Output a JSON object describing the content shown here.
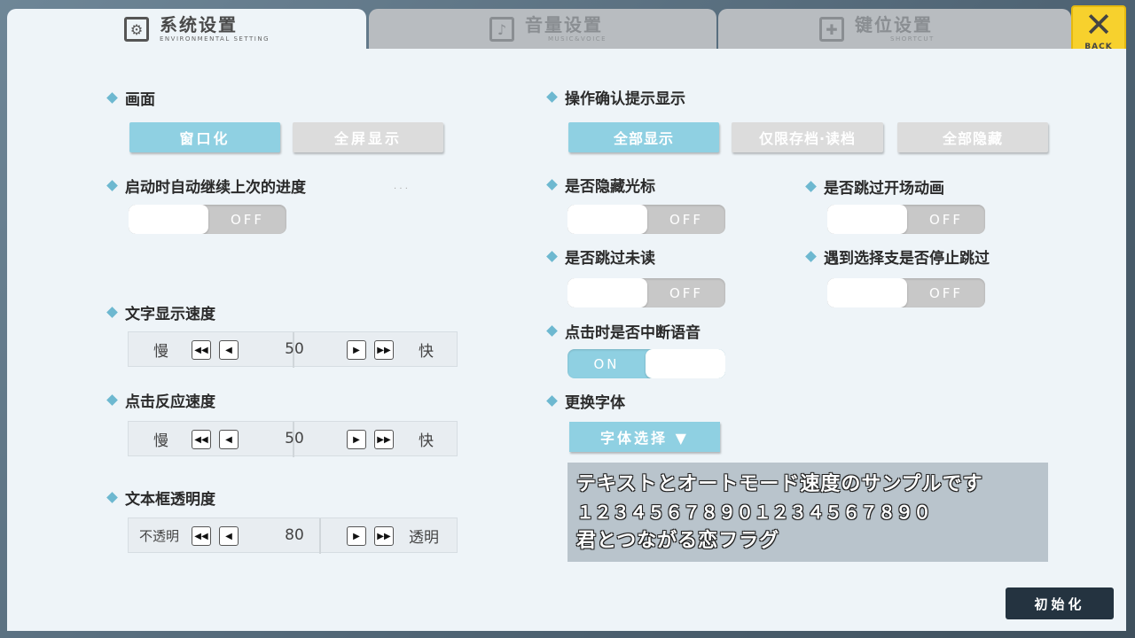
{
  "tabs": [
    {
      "title": "系统设置",
      "sub": "ENVIRONMENTAL SETTING",
      "icon": "⚙"
    },
    {
      "title": "音量设置",
      "sub": "MUSIC&VOICE",
      "icon": "♪"
    },
    {
      "title": "键位设置",
      "sub": "SHORTCUT",
      "icon": "✚"
    }
  ],
  "back": {
    "icon": "✕",
    "label": "BACK"
  },
  "left": {
    "screen": {
      "label": "画面",
      "options": [
        "窗口化",
        "全屏显示"
      ]
    },
    "auto_continue": {
      "label": "启动时自动继续上次的进度",
      "state": "OFF"
    },
    "text_speed": {
      "label": "文字显示速度",
      "min": "慢",
      "max": "快",
      "value": "50"
    },
    "click_speed": {
      "label": "点击反应速度",
      "min": "慢",
      "max": "快",
      "value": "50"
    },
    "opacity": {
      "label": "文本框透明度",
      "min": "不透明",
      "max": "透明",
      "value": "80"
    }
  },
  "right": {
    "confirm": {
      "label": "操作确认提示显示",
      "options": [
        "全部显示",
        "仅限存档·读档",
        "全部隐藏"
      ]
    },
    "hide_cursor": {
      "label": "是否隐藏光标",
      "state": "OFF"
    },
    "skip_opening": {
      "label": "是否跳过开场动画",
      "state": "OFF"
    },
    "skip_unread": {
      "label": "是否跳过未读",
      "state": "OFF"
    },
    "stop_skip_choice": {
      "label": "遇到选择支是否停止跳过",
      "state": "OFF"
    },
    "interrupt_voice": {
      "label": "点击时是否中断语音",
      "state": "ON"
    },
    "font": {
      "label": "更换字体",
      "dropdown": "字体选择 ▼"
    }
  },
  "sample": {
    "line1": "テキストとオートモード速度のサンプルです",
    "line2": "１２３４５６７８９０１２３４５６７８９０",
    "line3": "君とつながる恋フラグ"
  },
  "reset": {
    "label": "初始化"
  },
  "icons": {
    "rewind": "◀◀",
    "prev": "◀",
    "next": "▶",
    "fast": "▶▶"
  },
  "colors": {
    "accent": "#8fd0e2",
    "panel": "#eef4f8",
    "back": "#f7d12d"
  }
}
